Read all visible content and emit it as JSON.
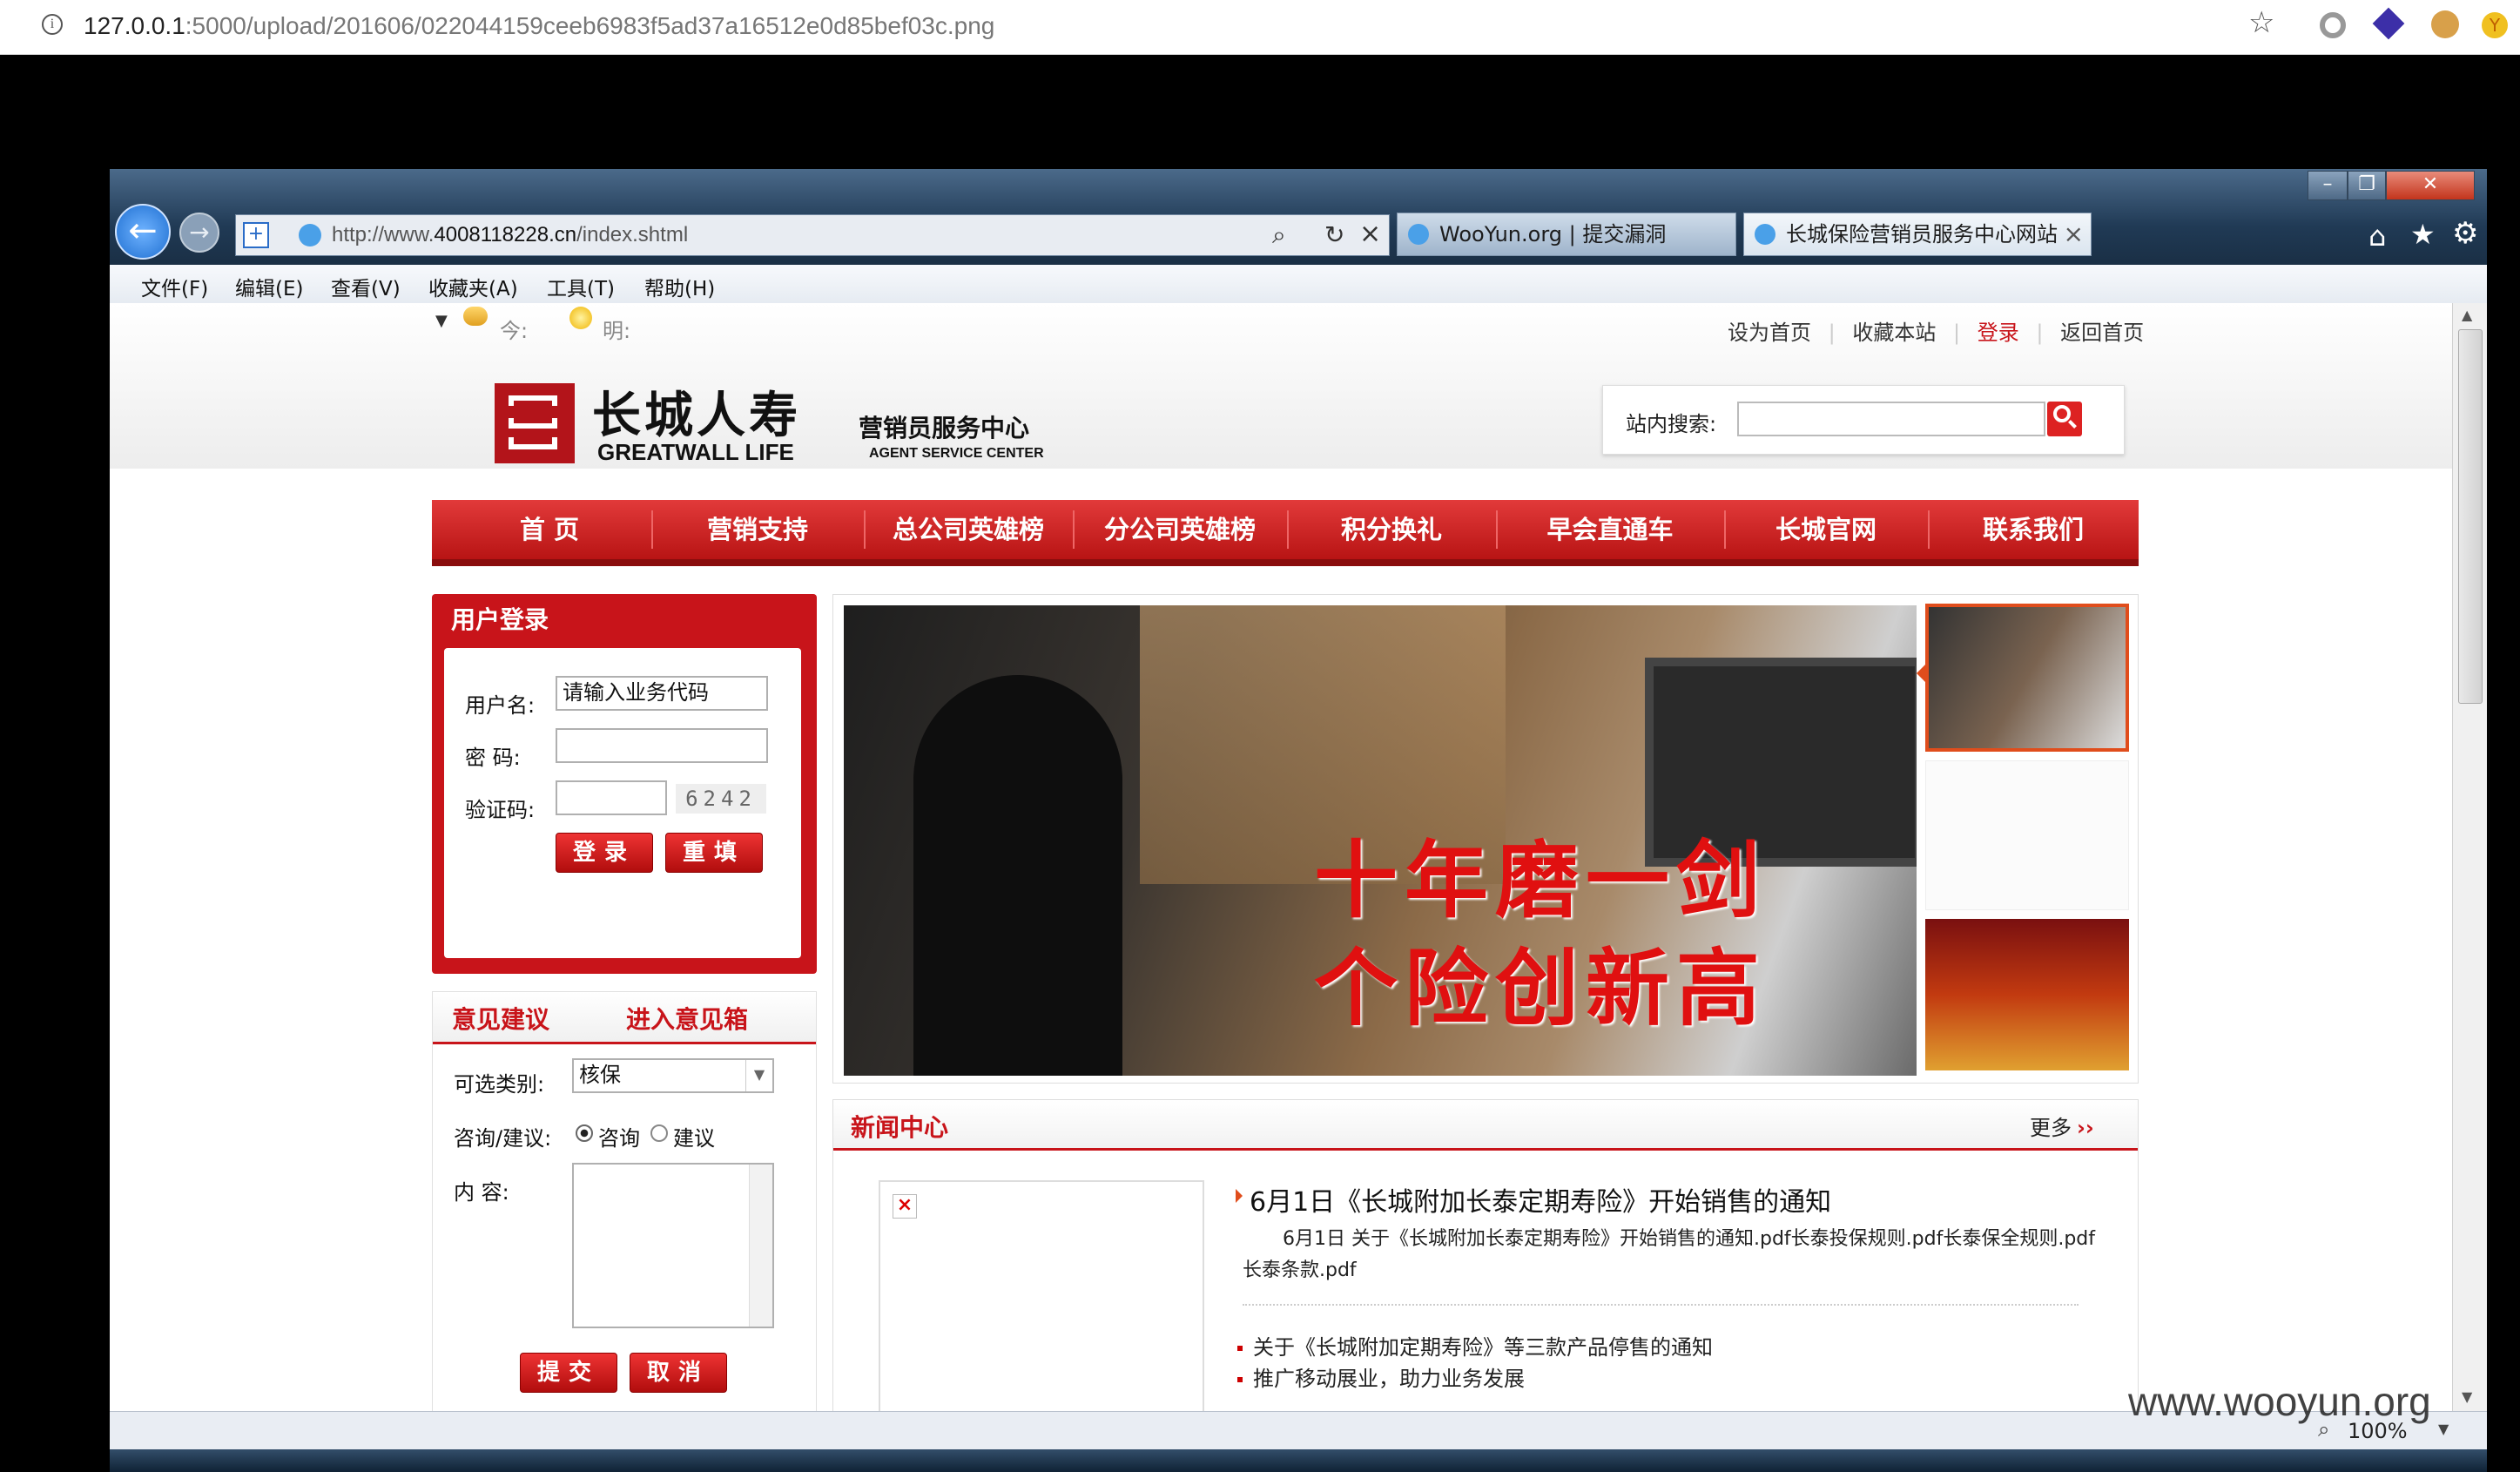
{
  "browser": {
    "url_host": "127.0.0.1",
    "url_rest": ":5000/upload/201606/022044159ceeb6983f5ad37a16512e0d85bef03c.png"
  },
  "ie": {
    "address_prefix": "http://www.",
    "address_domain": "4008118228.cn",
    "address_path": "/index.shtml",
    "tabs": [
      {
        "label": "WooYun.org | 提交漏洞"
      },
      {
        "label": "长城保险营销员服务中心网站"
      }
    ],
    "menu": [
      "文件(F)",
      "编辑(E)",
      "查看(V)",
      "收藏夹(A)",
      "工具(T)",
      "帮助(H)"
    ],
    "zoom": "100%"
  },
  "site": {
    "weather_today": "今:",
    "weather_tomorrow": "明:",
    "toplinks": [
      "设为首页",
      "收藏本站",
      "登录",
      "返回首页"
    ],
    "logo": {
      "cn": "长城人寿",
      "en": "GREATWALL LIFE",
      "sub_cn": "营销员服务中心",
      "sub_en": "AGENT SERVICE CENTER"
    },
    "search_label": "站内搜索:",
    "nav": [
      "首  页",
      "营销支持",
      "总公司英雄榜",
      "分公司英雄榜",
      "积分换礼",
      "早会直通车",
      "长城官网",
      "联系我们"
    ],
    "login": {
      "title": "用户登录",
      "username_label": "用户名:",
      "username_value": "请输入业务代码",
      "password_label": "密  码:",
      "captcha_label": "验证码:",
      "captcha_code": "6242",
      "login_btn": "登录",
      "reset_btn": "重填"
    },
    "feedback": {
      "title": "意见建议",
      "link": "进入意见箱",
      "category_label": "可选类别:",
      "category_value": "核保",
      "type_label": "咨询/建议:",
      "opt_consult": "咨询",
      "opt_suggest": "建议",
      "content_label": "内  容:",
      "submit_btn": "提交",
      "cancel_btn": "取消"
    },
    "banner": {
      "line1": "十年磨一剑",
      "line2": "个险创新高"
    },
    "news": {
      "title": "新闻中心",
      "more": "更多",
      "headline": "6月1日《长城附加长泰定期寿险》开始销售的通知",
      "summary": "6月1日 关于《长城附加长泰定期寿险》开始销售的通知.pdf长泰投保规则.pdf长泰保全规则.pdf长泰条款.pdf",
      "items": [
        "关于《长城附加定期寿险》等三款产品停售的通知",
        "推广移动展业，助力业务发展"
      ]
    }
  },
  "watermark": "www.wooyun.org",
  "colors": {
    "brand_red": "#c8141a",
    "nav_red": "#c41a1a"
  }
}
